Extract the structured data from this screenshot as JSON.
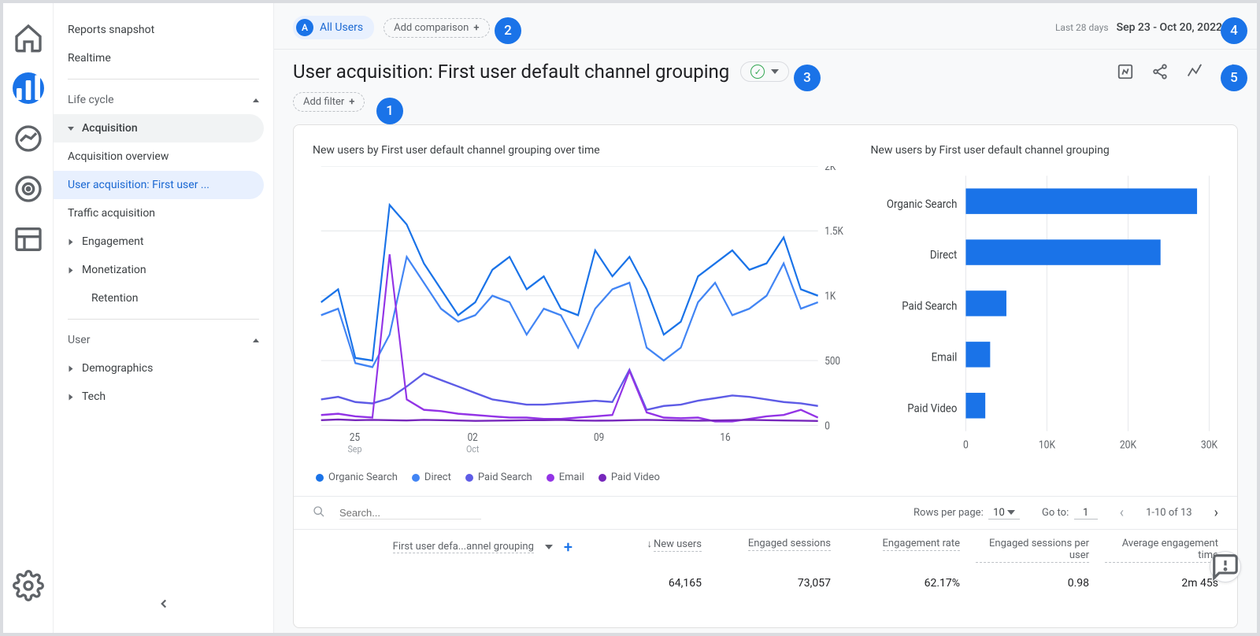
{
  "rail": {
    "items": [
      "home",
      "reports",
      "explore",
      "advertising",
      "configure"
    ],
    "active_index": 1
  },
  "nav": {
    "reports_snapshot": "Reports snapshot",
    "realtime": "Realtime",
    "life_cycle": "Life cycle",
    "acquisition": "Acquisition",
    "acq_overview": "Acquisition overview",
    "user_acq": "User acquisition: First user ...",
    "traffic_acq": "Traffic acquisition",
    "engagement": "Engagement",
    "monetization": "Monetization",
    "retention": "Retention",
    "user": "User",
    "demographics": "Demographics",
    "tech": "Tech"
  },
  "chips": {
    "segment_badge": "A",
    "segment_label": "All Users",
    "add_comparison": "Add comparison",
    "add_filter": "Add filter",
    "date_hint": "Last 28 days",
    "date_range": "Sep 23 - Oct 20, 2022"
  },
  "title": "User acquisition: First user default channel grouping",
  "callouts": {
    "n1": "1",
    "n2": "2",
    "n3": "3",
    "n4": "4",
    "n5": "5"
  },
  "chart_data": [
    {
      "type": "line",
      "title": "New users by First user default channel grouping over time",
      "ylim": [
        0,
        2000
      ],
      "yticks": [
        0,
        500,
        1000,
        1500,
        2000
      ],
      "xticks": [
        {
          "label": "25",
          "sub": "Sep",
          "x": 50
        },
        {
          "label": "02",
          "sub": "Oct",
          "x": 190
        },
        {
          "label": "09",
          "sub": "",
          "x": 340
        },
        {
          "label": "16",
          "sub": "",
          "x": 490
        }
      ],
      "series": [
        {
          "name": "Organic Search",
          "color": "#1a73e8",
          "values": [
            950,
            1050,
            520,
            500,
            1700,
            1550,
            1250,
            1050,
            850,
            950,
            1200,
            1300,
            1050,
            1150,
            900,
            850,
            1350,
            1150,
            1300,
            1050,
            700,
            800,
            1150,
            1250,
            1350,
            1200,
            1250,
            1450,
            1050,
            1000
          ]
        },
        {
          "name": "Direct",
          "color": "#4285f4",
          "values": [
            850,
            900,
            480,
            450,
            700,
            1300,
            1100,
            900,
            800,
            850,
            1000,
            950,
            700,
            900,
            850,
            600,
            900,
            1050,
            1100,
            600,
            500,
            600,
            950,
            1100,
            850,
            900,
            1000,
            1250,
            900,
            950
          ]
        },
        {
          "name": "Paid Search",
          "color": "#5e5ce6",
          "values": [
            200,
            220,
            180,
            170,
            210,
            300,
            400,
            350,
            300,
            250,
            200,
            180,
            160,
            160,
            170,
            180,
            190,
            180,
            430,
            120,
            150,
            160,
            190,
            210,
            230,
            220,
            200,
            180,
            170,
            150
          ]
        },
        {
          "name": "Email",
          "color": "#9334e6",
          "values": [
            80,
            90,
            70,
            60,
            1320,
            200,
            120,
            110,
            90,
            80,
            70,
            60,
            60,
            50,
            50,
            60,
            70,
            80,
            420,
            100,
            60,
            55,
            60,
            30,
            30,
            50,
            70,
            80,
            120,
            60
          ]
        },
        {
          "name": "Paid Video",
          "color": "#7627bb",
          "values": [
            40,
            45,
            40,
            42,
            40,
            38,
            42,
            40,
            38,
            35,
            36,
            38,
            40,
            40,
            42,
            38,
            36,
            37,
            40,
            42,
            40,
            38,
            36,
            38,
            40,
            42,
            40,
            38,
            36,
            34
          ]
        }
      ]
    },
    {
      "type": "bar",
      "orientation": "horizontal",
      "title": "New users by First user default channel grouping",
      "xlim": [
        0,
        30000
      ],
      "xticks": [
        0,
        10000,
        20000,
        30000
      ],
      "categories": [
        "Organic Search",
        "Direct",
        "Paid Search",
        "Email",
        "Paid Video"
      ],
      "values": [
        28500,
        24000,
        5000,
        3000,
        2400
      ],
      "color": "#1a73e8"
    }
  ],
  "table": {
    "search_placeholder": "Search...",
    "rows_per_page_label": "Rows per page:",
    "rows_per_page_value": "10",
    "goto_label": "Go to:",
    "goto_value": "1",
    "range_label": "1-10 of 13",
    "dimension_label": "First user defa...annel grouping",
    "columns": [
      "New users",
      "Engaged sessions",
      "Engagement rate",
      "Engaged sessions per user",
      "Average engagement time"
    ],
    "totals": [
      "64,165",
      "73,057",
      "62.17%",
      "0.98",
      "2m 45s"
    ]
  },
  "xtick_fmt": [
    "0",
    "10K",
    "20K",
    "30K"
  ]
}
